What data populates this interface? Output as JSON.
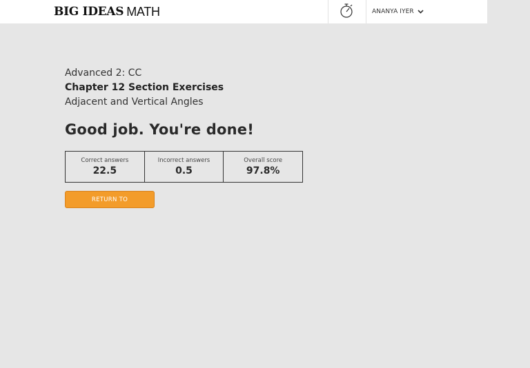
{
  "header": {
    "brand_bold": "BIG IDEAS",
    "brand_light": "MATH",
    "user_name": "ANANYA IYER"
  },
  "assignment": {
    "course": "Advanced 2: CC",
    "chapter": "Chapter 12 Section Exercises",
    "section": "Adjacent and Vertical Angles"
  },
  "result": {
    "message": "Good job. You're done!",
    "scores": [
      {
        "label": "Correct answers",
        "value": "22.5"
      },
      {
        "label": "Incorrect answers",
        "value": "0.5"
      },
      {
        "label": "Overall score",
        "value": "97.8%"
      }
    ]
  },
  "actions": {
    "return_label": "RETURN TO"
  },
  "icons": {
    "timer": "stopwatch-icon",
    "user_menu": "chevron-down-icon"
  },
  "colors": {
    "background": "#e6e6e6",
    "header": "#ffffff",
    "accent": "#f39c2a"
  }
}
